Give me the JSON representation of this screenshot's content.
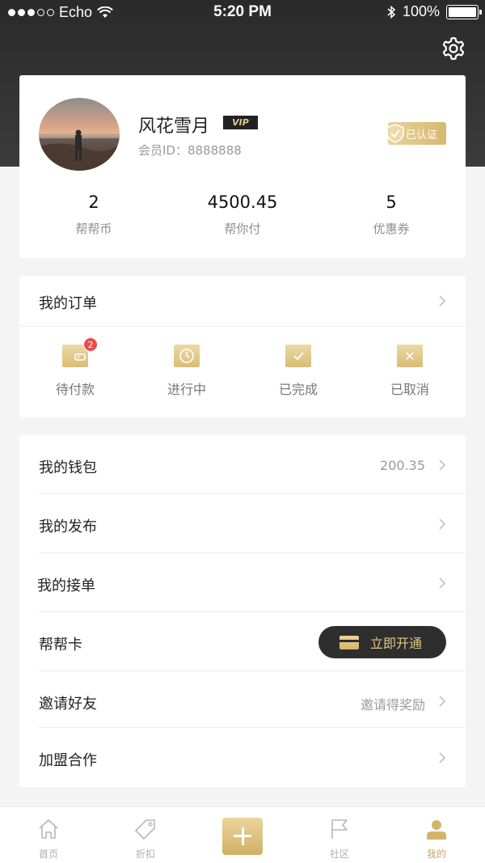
{
  "status_bar": {
    "carrier": "Echo",
    "time": "5:20 PM",
    "battery": "100%"
  },
  "profile": {
    "name": "风花雪月",
    "vip": "VIP",
    "member_id": "会员ID：8888888",
    "verified": "已认证",
    "stats": [
      {
        "value": "2",
        "label": "帮帮币"
      },
      {
        "value": "4500.45",
        "label": "帮你付"
      },
      {
        "value": "5",
        "label": "优惠券"
      }
    ]
  },
  "orders": {
    "title": "我的订单",
    "items": [
      {
        "label": "待付款",
        "icon": "wallet-icon",
        "badge": "2"
      },
      {
        "label": "进行中",
        "icon": "clock-icon"
      },
      {
        "label": "已完成",
        "icon": "check-icon"
      },
      {
        "label": "已取消",
        "icon": "cancel-icon"
      }
    ]
  },
  "menu": {
    "items": [
      {
        "label": "我的钱包",
        "value": "200.35"
      },
      {
        "label": "我的发布"
      },
      {
        "label": "我的接单"
      },
      {
        "label": "帮帮卡",
        "button": "立即开通"
      },
      {
        "label": "邀请好友",
        "value": "邀请得奖励"
      },
      {
        "label": "加盟合作"
      }
    ]
  },
  "tabbar": {
    "items": [
      {
        "label": "首页",
        "icon": "home-icon"
      },
      {
        "label": "折扣",
        "icon": "tag-icon"
      },
      {
        "label": "",
        "icon": "plus-icon"
      },
      {
        "label": "社区",
        "icon": "flag-icon"
      },
      {
        "label": "我的",
        "icon": "user-icon"
      }
    ],
    "active": "我的"
  },
  "colors": {
    "gold": "#d7b96e",
    "dark": "#2e2e2e",
    "badge_red": "#e94b4b"
  }
}
